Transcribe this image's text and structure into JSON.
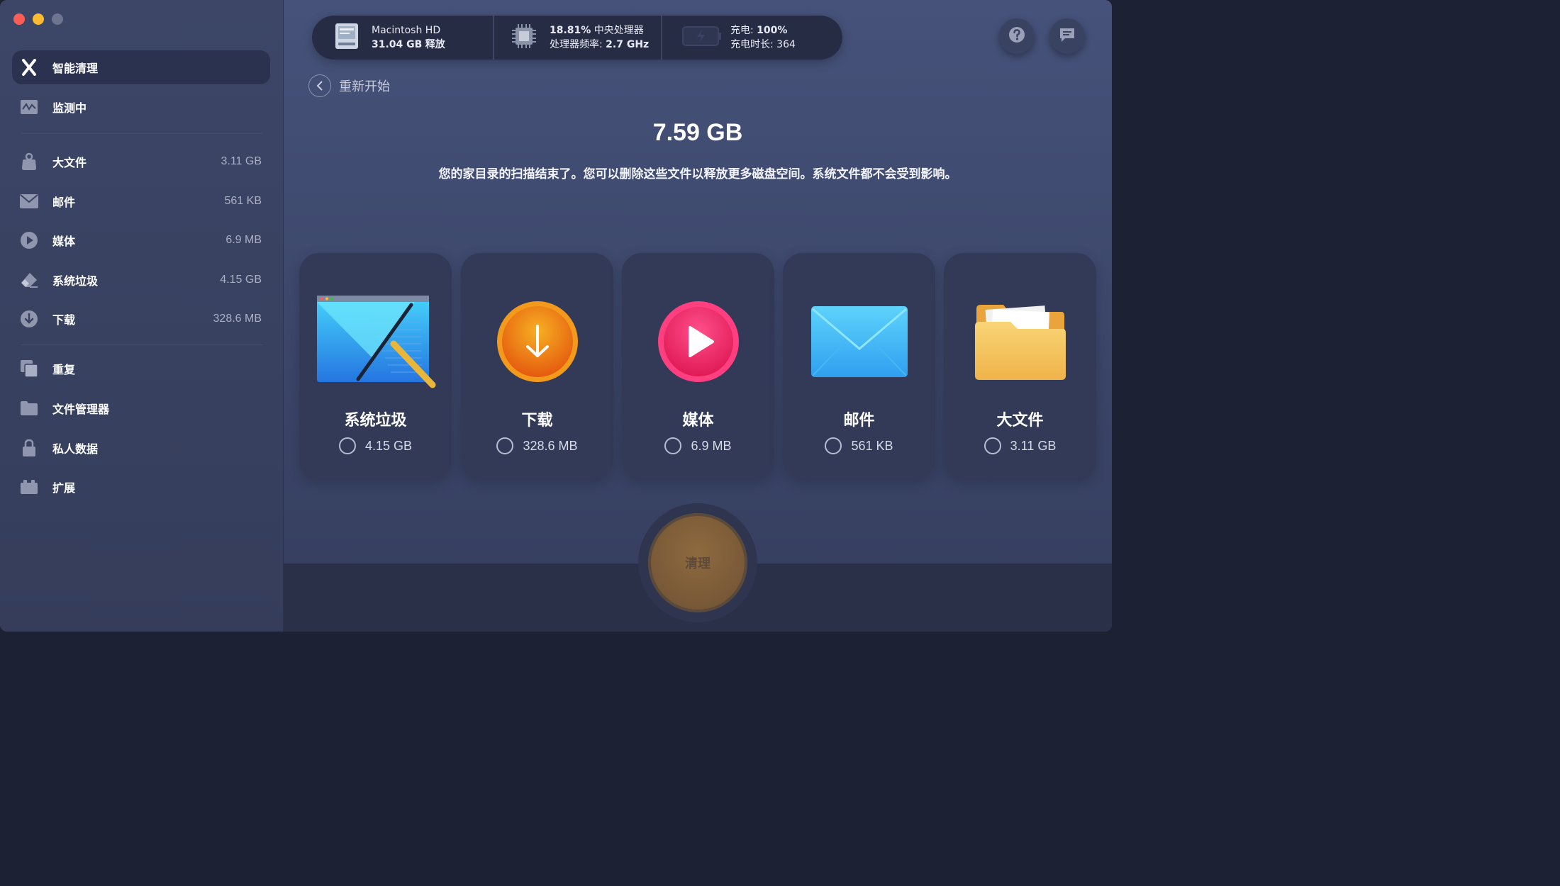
{
  "sidebar": {
    "items": [
      {
        "label": "智能清理",
        "size": "",
        "icon": "x-logo-icon",
        "active": true
      },
      {
        "label": "监测中",
        "size": "",
        "icon": "activity-monitor-icon"
      },
      {
        "label": "大文件",
        "size": "3.11 GB",
        "icon": "weight-icon"
      },
      {
        "label": "邮件",
        "size": "561 KB",
        "icon": "envelope-icon"
      },
      {
        "label": "媒体",
        "size": "6.9 MB",
        "icon": "play-icon"
      },
      {
        "label": "系统垃圾",
        "size": "4.15 GB",
        "icon": "eraser-icon"
      },
      {
        "label": "下载",
        "size": "328.6 MB",
        "icon": "download-icon"
      },
      {
        "label": "重复",
        "size": "",
        "icon": "duplicate-icon"
      },
      {
        "label": "文件管理器",
        "size": "",
        "icon": "folder-icon"
      },
      {
        "label": "私人数据",
        "size": "",
        "icon": "lock-icon"
      },
      {
        "label": "扩展",
        "size": "",
        "icon": "extension-icon"
      }
    ]
  },
  "status": {
    "disk": {
      "name": "Macintosh HD",
      "value": "31.04 GB",
      "value_label": "释放"
    },
    "cpu": {
      "usage": "18.81%",
      "usage_label": "中央处理器",
      "freq_label": "处理器频率:",
      "freq": "2.7 GHz"
    },
    "battery": {
      "charge_label": "充电:",
      "charge": "100%",
      "time_label": "充电时长:",
      "time": "364"
    }
  },
  "back": {
    "label": "重新开始"
  },
  "summary": {
    "total": "7.59 GB",
    "description": "您的家目录的扫描结束了。您可以删除这些文件以释放更多磁盘空间。系统文件都不会受到影响。"
  },
  "cards": [
    {
      "title": "系统垃圾",
      "size": "4.15 GB",
      "icon": "system-junk-icon"
    },
    {
      "title": "下载",
      "size": "328.6 MB",
      "icon": "download-icon"
    },
    {
      "title": "媒体",
      "size": "6.9 MB",
      "icon": "media-play-icon"
    },
    {
      "title": "邮件",
      "size": "561 KB",
      "icon": "mail-envelope-icon"
    },
    {
      "title": "大文件",
      "size": "3.11 GB",
      "icon": "folder-icon"
    }
  ],
  "clean_button": {
    "label": "清理"
  },
  "colors": {
    "accent_orange": "#f07b1b",
    "accent_pink": "#f0336b",
    "accent_blue": "#3fb1f3",
    "accent_yellow": "#f5c45a"
  }
}
